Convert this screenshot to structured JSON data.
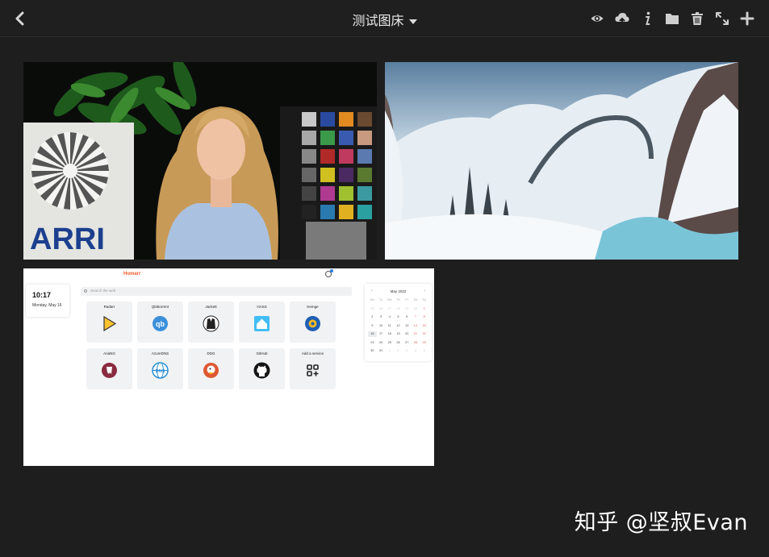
{
  "header": {
    "album_title": "测试图床",
    "tools": [
      {
        "name": "view-icon"
      },
      {
        "name": "upload-icon"
      },
      {
        "name": "info-icon"
      },
      {
        "name": "folder-icon"
      },
      {
        "name": "trash-icon"
      },
      {
        "name": "fullscreen-icon"
      },
      {
        "name": "add-icon"
      }
    ]
  },
  "thumbnails": [
    {
      "brand_text": "ARRI"
    },
    {},
    {
      "homarr": {
        "brand": "Homarr",
        "time": "10:17",
        "date": "Monday, May 16",
        "search_placeholder": "Search the web",
        "tiles": [
          {
            "label": "Radarr",
            "icon": "radarr-icon",
            "color": "#ffc230"
          },
          {
            "label": "Qbittorrent",
            "icon": "qbittorrent-icon",
            "color": "#3b8fd9"
          },
          {
            "label": "Jackett",
            "icon": "jackett-icon",
            "color": "#222222"
          },
          {
            "label": "HASS",
            "icon": "home-assistant-icon",
            "color": "#41bdf5"
          },
          {
            "label": "Kemge",
            "icon": "kemge-icon",
            "color": "#1e5fb4"
          },
          {
            "label": "AriaNG",
            "icon": "ariang-icon",
            "color": "#8a2b3f"
          },
          {
            "label": "AzureDNS",
            "icon": "azuredns-icon",
            "color": "#2a8fd3"
          },
          {
            "label": "DDG",
            "icon": "duckduckgo-icon",
            "color": "#de5833"
          },
          {
            "label": "GitHub",
            "icon": "github-icon",
            "color": "#161616"
          },
          {
            "label": "Add a service",
            "icon": "add-service-icon",
            "color": "#222222"
          }
        ],
        "calendar": {
          "title": "May 2022",
          "weekdays": [
            "Mo",
            "Tu",
            "We",
            "Th",
            "Fr",
            "Sa",
            "Su"
          ],
          "days": [
            "25",
            "26",
            "27",
            "28",
            "29",
            "30",
            "1",
            "2",
            "3",
            "4",
            "5",
            "6",
            "7",
            "8",
            "9",
            "10",
            "11",
            "12",
            "13",
            "14",
            "15",
            "16",
            "17",
            "18",
            "19",
            "20",
            "21",
            "22",
            "23",
            "24",
            "25",
            "26",
            "27",
            "28",
            "29",
            "30",
            "31",
            "1",
            "2",
            "3",
            "4",
            "5"
          ]
        }
      }
    }
  ],
  "watermark": "知乎 @坚叔Evan"
}
